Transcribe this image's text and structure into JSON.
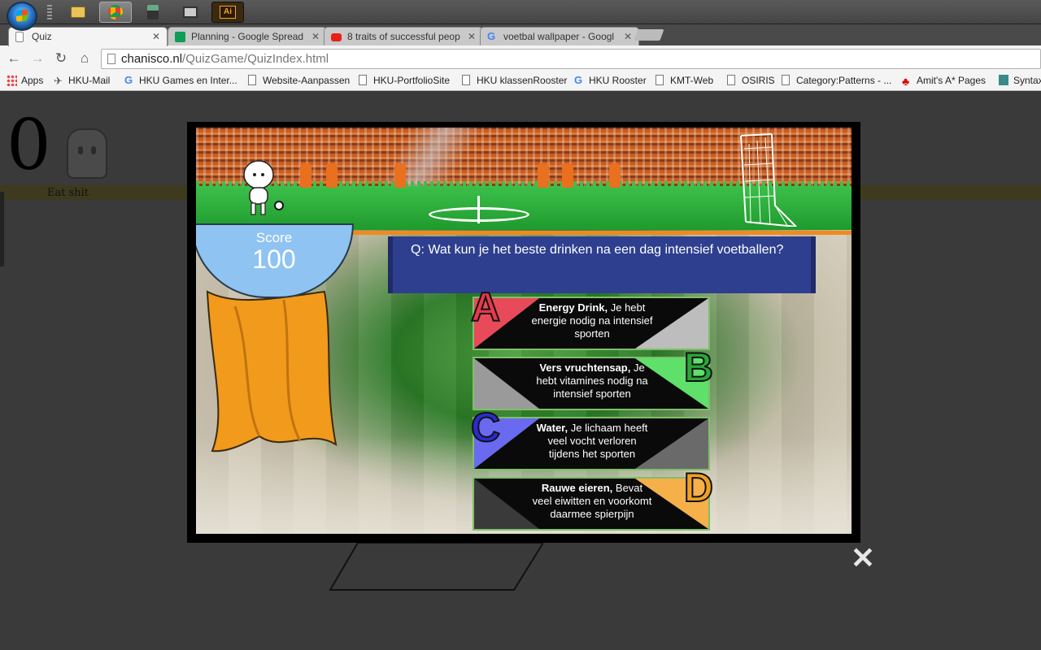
{
  "taskbar": {
    "buttons": [
      "windows-explorer",
      "chrome",
      "snipping-tool",
      "remote-desktop",
      "illustrator"
    ],
    "illustrator_label": "Ai"
  },
  "tabs": [
    {
      "label": "Quiz",
      "active": true
    },
    {
      "label": "Planning - Google Spread",
      "active": false
    },
    {
      "label": "8 traits of successful peop",
      "active": false
    },
    {
      "label": "voetbal wallpaper - Googl",
      "active": false
    }
  ],
  "tab_close": "✕",
  "toolbar": {
    "back": "←",
    "forward": "→",
    "reload": "↻",
    "home": "⌂"
  },
  "address": {
    "host": "chanisco.nl",
    "path": "/QuizGame/QuizIndex.html"
  },
  "bookmarks": [
    "Apps",
    "HKU-Mail",
    "HKU Games en Inter...",
    "Website-Aanpassen",
    "HKU-PortfolioSite",
    "HKU klassenRooster",
    "HKU Rooster",
    "KMT-Web",
    "OSIRIS",
    "Category:Patterns - ...",
    "Amit's A* Pages",
    "Syntax"
  ],
  "page": {
    "counter": "0",
    "caption": "Eat shit"
  },
  "quiz": {
    "score_label": "Score",
    "score_value": "100",
    "question": "Q: Wat kun je het beste drinken na een dag intensief voetballen?",
    "answers": [
      {
        "letter": "A",
        "bold": "Energy Drink,",
        "rest": " Je hebt energie nodig na intensief sporten",
        "color": "#e84a5a"
      },
      {
        "letter": "B",
        "bold": "Vers vruchtensap,",
        "rest": " Je hebt vitamines nodig na intensief sporten",
        "color": "#2aa63a"
      },
      {
        "letter": "C",
        "bold": "Water,",
        "rest": " Je lichaam heeft veel vocht verloren tijdens het sporten",
        "color": "#2a3ac8"
      },
      {
        "letter": "D",
        "bold": "Rauwe eieren,",
        "rest": " Bevat veel eiwitten en voorkomt daarmee spierpijn",
        "color": "#f0a020"
      }
    ]
  },
  "close_glyph": "✕"
}
